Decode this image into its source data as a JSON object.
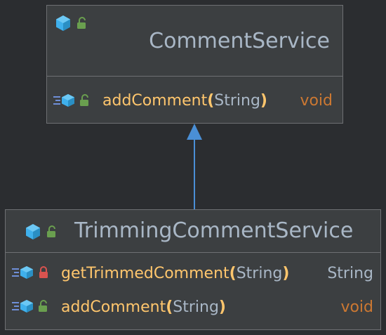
{
  "colors": {
    "background": "#2b2d30",
    "node_fill": "#3c3f41",
    "node_border": "#6e7073",
    "class_name": "#a9b7c6",
    "method_name": "#ffc66d",
    "return_keyword": "#cc7832",
    "arrow": "#4a8fd6",
    "class_icon": "#3fb0ec",
    "public_lock": "#6a9f4f",
    "private_lock": "#d9534f"
  },
  "classes": [
    {
      "name": "CommentService",
      "icon": "class-cube-icon",
      "visibility_icon": "unlocked-lock-icon",
      "members": [
        {
          "kind_icon": "method-icon",
          "visibility_icon": "unlocked-lock-icon",
          "name": "addComment",
          "open_paren": "(",
          "params": "String",
          "close_paren": ")",
          "return": "void"
        }
      ]
    },
    {
      "name": "TrimmingCommentService",
      "icon": "class-cube-icon",
      "visibility_icon": "unlocked-lock-icon",
      "members": [
        {
          "kind_icon": "method-icon",
          "visibility_icon": "locked-lock-icon",
          "name": "getTrimmedComment",
          "open_paren": "(",
          "params": "String",
          "close_paren": ")",
          "return": "String"
        },
        {
          "kind_icon": "method-icon",
          "visibility_icon": "unlocked-lock-icon",
          "name": "addComment",
          "open_paren": "(",
          "params": "String",
          "close_paren": ")",
          "return": "void"
        }
      ]
    }
  ],
  "relationships": [
    {
      "type": "inheritance",
      "from": "TrimmingCommentService",
      "to": "CommentService"
    }
  ]
}
